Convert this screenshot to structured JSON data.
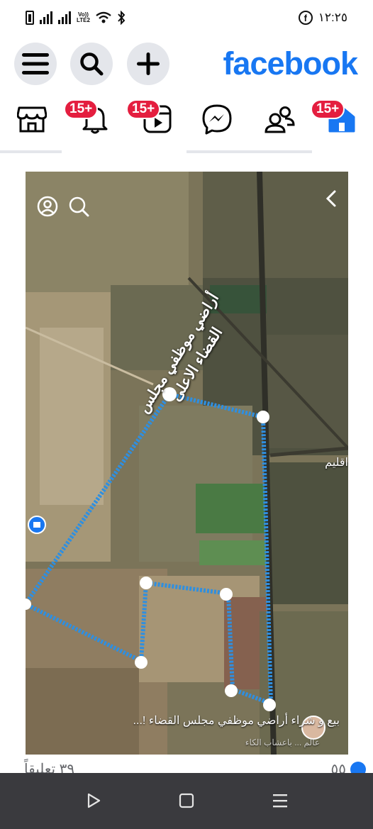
{
  "status_bar": {
    "time": "١٢:٢٥",
    "volte_top": "Vo))",
    "volte_bottom": "LTE2",
    "notification_glyph": "f"
  },
  "header": {
    "logo": "facebook",
    "brand_color": "#1877f2"
  },
  "nav": {
    "items": [
      {
        "icon": "marketplace-icon",
        "badge": ""
      },
      {
        "icon": "bell-icon",
        "badge": "15+"
      },
      {
        "icon": "video-icon",
        "badge": "15+"
      },
      {
        "icon": "messenger-icon",
        "badge": ""
      },
      {
        "icon": "friends-icon",
        "badge": ""
      },
      {
        "icon": "home-icon",
        "badge": "15+"
      }
    ]
  },
  "story": {
    "map_title": "أراضي موظفي مجلس القضاء الاعلى",
    "road_label": "اقليم",
    "caption": "بيع و شراء أراضي موظفي مجلس القضاء !...",
    "caption_sub": "عالم ... باعشاب الكاء"
  },
  "reactions": {
    "count_left": "٣٩ تعليقاً",
    "count_right": "٥٥"
  }
}
